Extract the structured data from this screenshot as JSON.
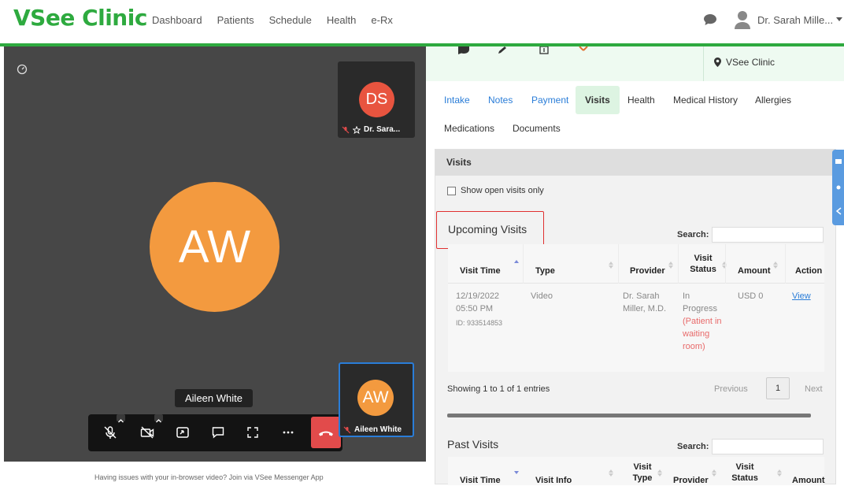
{
  "app": {
    "logo": "VSee Clinic",
    "brand_color": "#2eaa3f"
  },
  "nav": {
    "items": [
      "Dashboard",
      "Patients",
      "Schedule",
      "Health",
      "e-Rx"
    ]
  },
  "user": {
    "name": "Dr. Sarah Mille..."
  },
  "video": {
    "remote_tile": {
      "initials": "DS",
      "label": "Dr. Sara...",
      "color": "#e8543f"
    },
    "main_participant": {
      "initials": "AW",
      "color": "#f39a3f"
    },
    "name_tooltip": "Aileen White",
    "self_tile": {
      "initials": "AW",
      "label": "Aileen White"
    },
    "issue_text": "Having issues with your in-browser video? Join via VSee Messenger App"
  },
  "clinic": {
    "name": "VSee Clinic"
  },
  "tabs": [
    {
      "label": "Intake"
    },
    {
      "label": "Notes"
    },
    {
      "label": "Payment"
    },
    {
      "label": "Visits",
      "active": true
    },
    {
      "label": "Health"
    },
    {
      "label": "Medical History"
    },
    {
      "label": "Allergies"
    },
    {
      "label": "Medications"
    },
    {
      "label": "Documents"
    }
  ],
  "visits": {
    "header": "Visits",
    "open_only_label": "Show open visits only",
    "upcoming_title": "Upcoming Visits",
    "search_label": "Search:",
    "columns": [
      "Visit Time",
      "Type",
      "Provider",
      "Visit Status",
      "Amount",
      "Action"
    ],
    "row": {
      "visit_time": "12/19/2022 05:50 PM",
      "visit_id": "ID: 933514853",
      "type": "Video",
      "provider": "Dr. Sarah Miller, M.D.",
      "status": "In Progress",
      "status_note": "(Patient in waiting room)",
      "amount": "USD 0",
      "action": "View"
    },
    "info": "Showing 1 to 1 of 1 entries",
    "previous": "Previous",
    "page": "1",
    "next": "Next",
    "past_title": "Past Visits",
    "past_search_label": "Search:",
    "past_columns": [
      "Visit Time",
      "Visit Info",
      "Visit Type",
      "Provider",
      "Visit Status",
      "Amount"
    ]
  }
}
